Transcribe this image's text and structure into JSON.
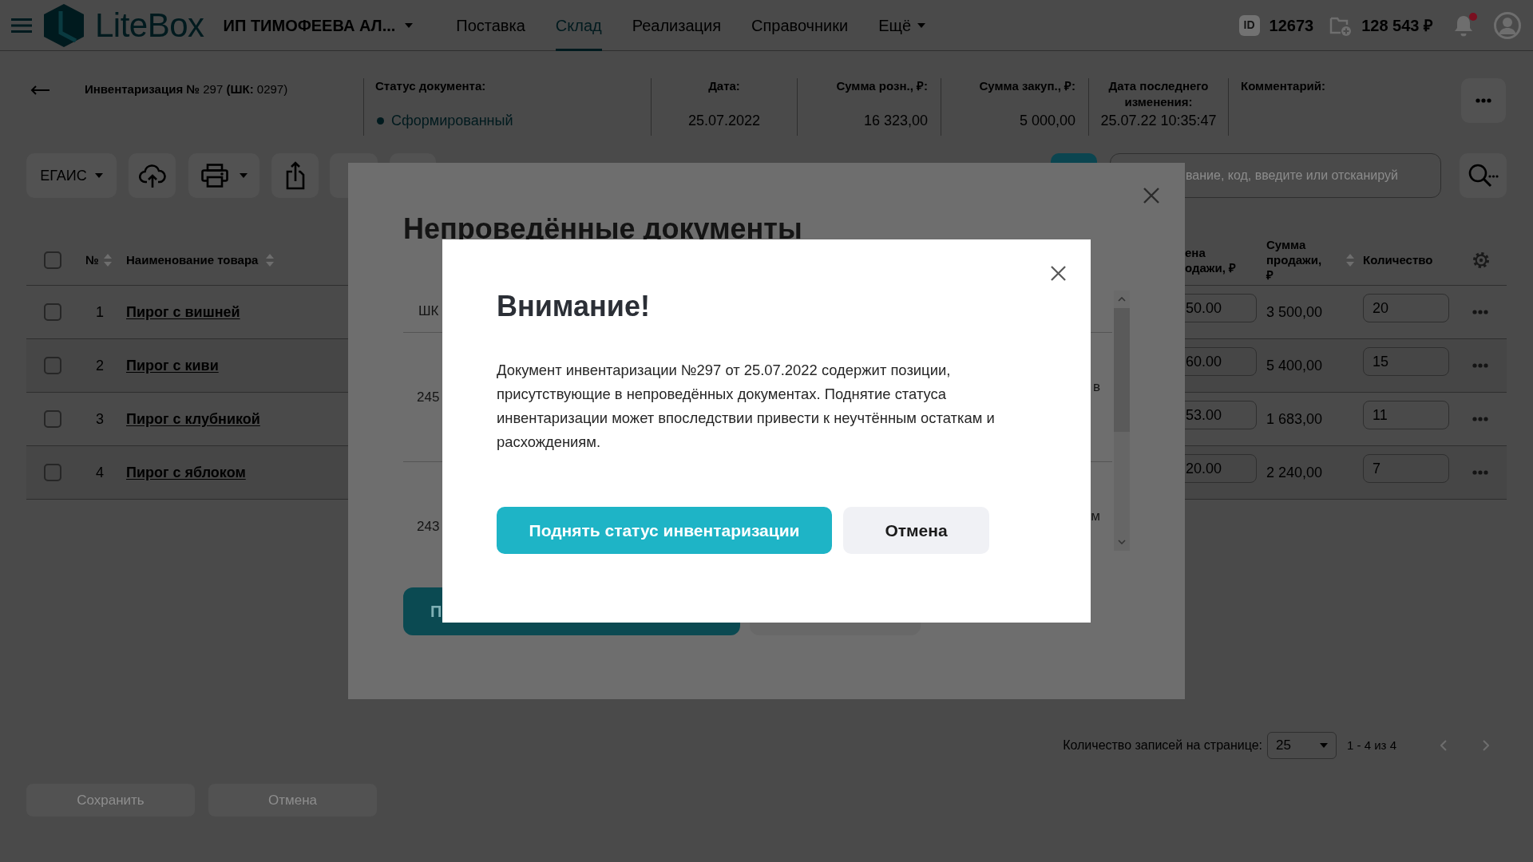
{
  "header": {
    "brand": "LiteBox",
    "company": "ИП ТИМОФЕЕВА АЛ...",
    "nav": [
      {
        "label": "Поставка",
        "selected": false,
        "dropdown": false
      },
      {
        "label": "Склад",
        "selected": true,
        "dropdown": false
      },
      {
        "label": "Реализация",
        "selected": false,
        "dropdown": false
      },
      {
        "label": "Справочники",
        "selected": false,
        "dropdown": false
      },
      {
        "label": "Ещё",
        "selected": false,
        "dropdown": true
      }
    ],
    "id_badge": "ID",
    "account_id": "12673",
    "balance": "128 543 ₽",
    "has_unread_notifications": true
  },
  "document": {
    "title": "**Инвентаризация №** 297 **(ШК:** 0297)",
    "fields": [
      {
        "kind": "status",
        "label": "Статус документа:",
        "value": "Сформированный"
      },
      {
        "kind": "date",
        "label": "Дата:",
        "value": "25.07.2022"
      },
      {
        "kind": "amount",
        "label": "Сумма розн., ₽:",
        "value": "16 323,00"
      },
      {
        "kind": "amount",
        "label": "Сумма закуп., ₽:",
        "value": "5 000,00"
      },
      {
        "kind": "date",
        "label": "Дата последнего изменения:",
        "value": "25.07.22 10:35:47"
      },
      {
        "kind": "comment",
        "label": "Комментарий:"
      }
    ]
  },
  "toolbar": {
    "egais_label": "ЕГАИС",
    "search": {
      "placeholder": "вание, код, введите или отсканируй"
    }
  },
  "table": {
    "all_checked": false,
    "columns": [
      {
        "label": "№",
        "sortable": true
      },
      {
        "label": "Наименование товара",
        "sortable": true
      },
      {
        "label": "ена одажи, ₽",
        "sortable": false
      },
      {
        "label": "Сумма продажи, ₽",
        "sortable": true
      },
      {
        "label": "Количество",
        "sortable": false
      }
    ],
    "rows": [
      {
        "checked": false,
        "number": "1",
        "name": "Пирог с вишней",
        "price": "50.00",
        "sum": "3 500,00",
        "quantity": "20"
      },
      {
        "checked": false,
        "number": "2",
        "name": "Пирог с киви",
        "price": "60.00",
        "sum": "5 400,00",
        "quantity": "15"
      },
      {
        "checked": false,
        "number": "3",
        "name": "Пирог с клубникой",
        "price": "53.00",
        "sum": "1 683,00",
        "quantity": "11"
      },
      {
        "checked": false,
        "number": "4",
        "name": "Пирог с яблоком",
        "price": "20.00",
        "sum": "2 240,00",
        "quantity": "7"
      }
    ]
  },
  "pagination": {
    "label": "Количество записей на странице:",
    "page_size": "25",
    "range": "1 - 4 из 4"
  },
  "footer_buttons": [
    {
      "label": "Сохранить",
      "disabled": true
    },
    {
      "label": "Отмена",
      "disabled": true
    }
  ],
  "unposted_dialog": {
    "title": "Непроведённые документы",
    "columns": [
      {
        "label": "ШК"
      }
    ],
    "rows": [
      {
        "column_1": "245",
        "column_2": "в"
      },
      {
        "column_1": "243",
        "column_2": "м"
      }
    ],
    "buttons": [
      {
        "kind": "primary",
        "label": "П"
      },
      {
        "kind": "secondary"
      }
    ]
  },
  "warning_dialog": {
    "title": "Внимание!",
    "message": "Документ инвентаризации №297 от 25.07.2022 содержит позиции, присутствующие в непроведённых документах. Поднятие статуса инвентаризации может впоследствии привести к неучтённым остаткам и расхождениям.",
    "buttons": [
      {
        "kind": "primary",
        "label": "Поднять статус инвентаризации"
      },
      {
        "kind": "secondary",
        "label": "Отмена"
      }
    ]
  }
}
